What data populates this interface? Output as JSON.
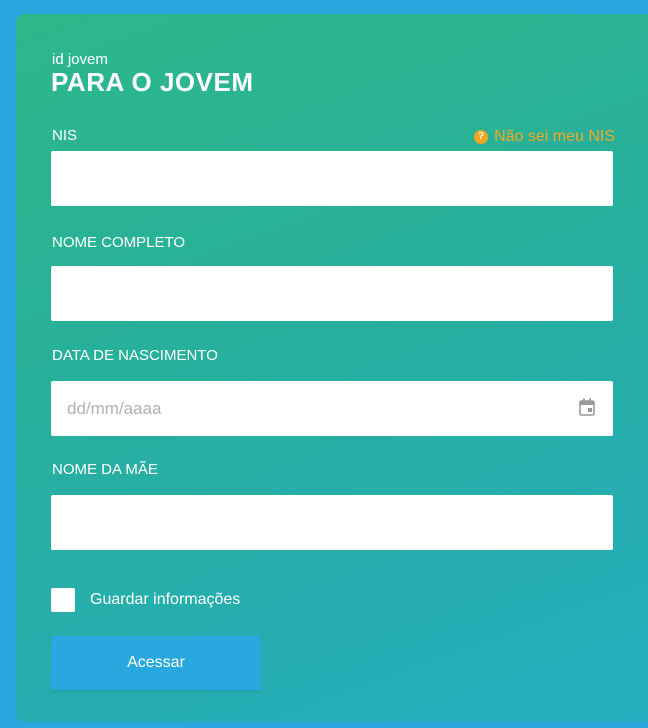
{
  "brand": {
    "small": "id jovem",
    "title": "PARA O JOVEM"
  },
  "form": {
    "nis": {
      "label": "NIS",
      "value": "",
      "placeholder": ""
    },
    "help_link": {
      "label": "Não sei meu NIS",
      "icon": "question-circle-icon"
    },
    "nome_completo": {
      "label": "NOME COMPLETO",
      "value": "",
      "placeholder": ""
    },
    "data_nascimento": {
      "label": "DATA DE NASCIMENTO",
      "value": "",
      "placeholder": "dd/mm/aaaa",
      "icon": "calendar-icon"
    },
    "nome_mae": {
      "label": "NOME DA MÃE",
      "value": "",
      "placeholder": ""
    },
    "remember": {
      "label": "Guardar informações",
      "checked": false
    },
    "submit": {
      "label": "Acessar"
    }
  },
  "colors": {
    "background": "#29a8e0",
    "card_gradient_start": "#2db88a",
    "card_gradient_end": "#26aec0",
    "help_link": "#f5a623",
    "button": "#29a8e0"
  }
}
